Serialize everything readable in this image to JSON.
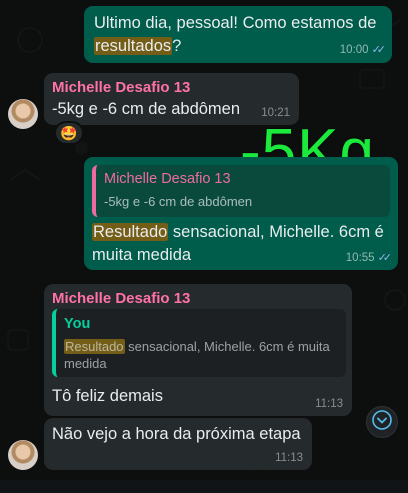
{
  "messages": {
    "m1": {
      "text_before": "Ultimo dia, pessoal! Como estamos de ",
      "highlight": "resultados",
      "text_after": "?",
      "time": "10:00"
    },
    "m2": {
      "sender": "Michelle Desafio 13",
      "text": "-5kg e -6 cm de abdômen",
      "time": "10:21",
      "reaction": "🤩"
    },
    "sticker": {
      "text": "-5Kg"
    },
    "m3": {
      "quote_sender": "Michelle Desafio 13",
      "quote_text": "-5kg e -6 cm de abdômen",
      "highlight": "Resultado",
      "text_line1_rest": " sensacional, Michelle. 6cm é",
      "text_line2": "muita medida",
      "time": "10:55"
    },
    "m4": {
      "sender": "Michelle Desafio 13",
      "quote_sender": "You",
      "quote_highlight": "Resultado",
      "quote_line1_rest": " sensacional, Michelle. 6cm é muita",
      "quote_line2": "medida",
      "text": "Tô feliz demais",
      "time": "11:13"
    },
    "m5": {
      "text": "Não vejo a hora da próxima etapa",
      "time": "11:13"
    }
  },
  "colors": {
    "outgoing_bubble": "#005c4b",
    "incoming_bubble": "#252a2d",
    "sender_name": "#ff72a8",
    "you_name": "#06cf9c",
    "sticker_green": "#1bea3d",
    "read_ticks": "#8bb7ea"
  },
  "icons": {
    "read_receipt": "double-check-icon",
    "scroll_down": "chevron-down-icon"
  }
}
